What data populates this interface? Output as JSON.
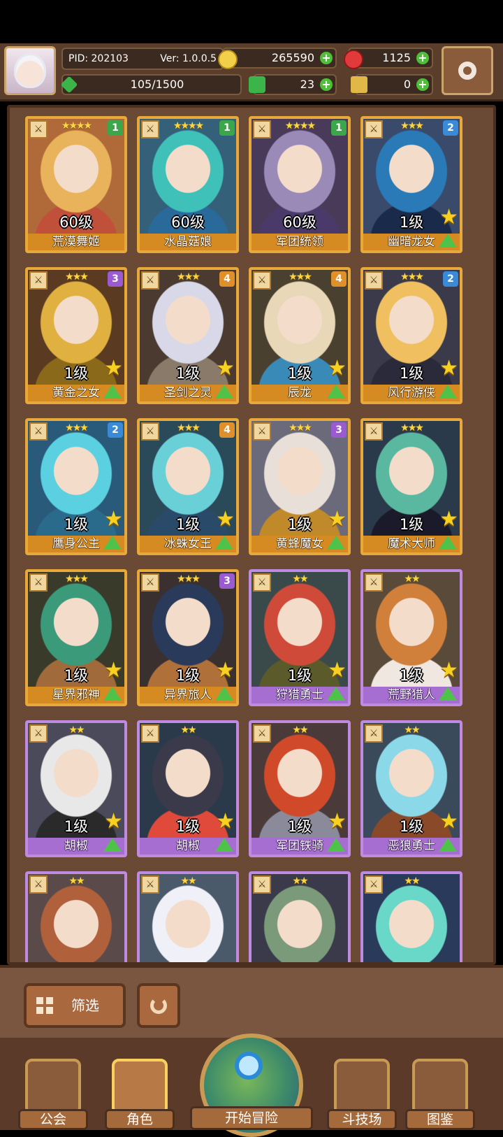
{
  "header": {
    "pid": "PID: 202103",
    "version": "Ver: 1.0.0.5",
    "gold": "265590",
    "gems": "1125",
    "energy": "105/1500",
    "clover": "23",
    "key": "0"
  },
  "cards": [
    {
      "level": "60级",
      "name": "荒漠舞姬",
      "stars": "★★★★",
      "badge": "1",
      "rarity": "gold",
      "colors": [
        "#e8b35a",
        "#c0503a"
      ],
      "bg": "#b06a3a",
      "star": false
    },
    {
      "level": "60级",
      "name": "水晶菇娘",
      "stars": "★★★★",
      "badge": "1",
      "rarity": "gold",
      "colors": [
        "#3fc0b8",
        "#2a6a9a"
      ],
      "bg": "#35607a",
      "star": false
    },
    {
      "level": "60级",
      "name": "军团统领",
      "stars": "★★★★",
      "badge": "1",
      "rarity": "gold",
      "colors": [
        "#9a8ab8",
        "#4a3a6a"
      ],
      "bg": "#4a3a5a",
      "star": false
    },
    {
      "level": "1级",
      "name": "幽暗龙女",
      "stars": "★★★",
      "badge": "2",
      "rarity": "gold",
      "colors": [
        "#2a7ab8",
        "#1a2a4a"
      ],
      "bg": "#3a4a6a",
      "star": true
    },
    {
      "level": "1级",
      "name": "黄金之女",
      "stars": "★★★",
      "badge": "3",
      "rarity": "gold",
      "colors": [
        "#e0b040",
        "#8a6a1a"
      ],
      "bg": "#5a3a20",
      "star": true
    },
    {
      "level": "1级",
      "name": "圣剑之灵",
      "stars": "★★★",
      "badge": "4",
      "rarity": "gold",
      "colors": [
        "#d8d8e8",
        "#8a7a6a"
      ],
      "bg": "#4a3a30",
      "star": true
    },
    {
      "level": "1级",
      "name": "辰龙",
      "stars": "★★★",
      "badge": "4",
      "rarity": "gold",
      "colors": [
        "#e8d8b8",
        "#3a8ab8"
      ],
      "bg": "#4a4030",
      "star": true
    },
    {
      "level": "1级",
      "name": "风行游侠",
      "stars": "★★★",
      "badge": "2",
      "rarity": "gold",
      "colors": [
        "#f0c060",
        "#2a2a3a"
      ],
      "bg": "#3a3a4a",
      "star": true
    },
    {
      "level": "1级",
      "name": "鹰身公主",
      "stars": "★★★",
      "badge": "2",
      "rarity": "gold",
      "colors": [
        "#5ad0e0",
        "#2a6a8a"
      ],
      "bg": "#2a5a7a",
      "star": true
    },
    {
      "level": "1级",
      "name": "冰蛛女王",
      "stars": "★★★",
      "badge": "4",
      "rarity": "gold",
      "colors": [
        "#6ad0d8",
        "#2a4a6a"
      ],
      "bg": "#2a4a5a",
      "star": true
    },
    {
      "level": "1级",
      "name": "黄蜂魔女",
      "stars": "★★★",
      "badge": "3",
      "rarity": "gold",
      "colors": [
        "#e8e0d8",
        "#c08a2a"
      ],
      "bg": "#6a6a7a",
      "star": true
    },
    {
      "level": "1级",
      "name": "魔术大师",
      "stars": "★★★",
      "badge": "",
      "rarity": "gold",
      "colors": [
        "#5ab8a0",
        "#1a1a2a"
      ],
      "bg": "#2a3a4a",
      "star": true
    },
    {
      "level": "1级",
      "name": "星界邪神",
      "stars": "★★★",
      "badge": "",
      "rarity": "gold",
      "colors": [
        "#3a9a7a",
        "#a06a3a"
      ],
      "bg": "#3a3a2a",
      "star": true
    },
    {
      "level": "1级",
      "name": "异界旅人",
      "stars": "★★★",
      "badge": "3",
      "rarity": "gold",
      "colors": [
        "#2a3a5a",
        "#b0703a"
      ],
      "bg": "#3a3030",
      "star": true
    },
    {
      "level": "1级",
      "name": "狩猎勇士",
      "stars": "★★",
      "badge": "",
      "rarity": "purple",
      "colors": [
        "#d04a3a",
        "#5a5a2a"
      ],
      "bg": "#3a4a4a",
      "star": true
    },
    {
      "level": "1级",
      "name": "荒野猎人",
      "stars": "★★",
      "badge": "",
      "rarity": "purple",
      "colors": [
        "#d0803a",
        "#f0e8e0"
      ],
      "bg": "#5a4a3a",
      "star": true
    },
    {
      "level": "1级",
      "name": "胡椒",
      "stars": "★★",
      "badge": "",
      "rarity": "purple",
      "colors": [
        "#e8e8e8",
        "#2a2a2a"
      ],
      "bg": "#4a4a5a",
      "star": true
    },
    {
      "level": "1级",
      "name": "胡椒",
      "stars": "★★",
      "badge": "",
      "rarity": "purple",
      "colors": [
        "#3a3a4a",
        "#e04a3a"
      ],
      "bg": "#2a3a4a",
      "star": true
    },
    {
      "level": "1级",
      "name": "军团铁骑",
      "stars": "★★",
      "badge": "",
      "rarity": "purple",
      "colors": [
        "#d04a2a",
        "#8a8a9a"
      ],
      "bg": "#4a3a3a",
      "star": true
    },
    {
      "level": "1级",
      "name": "恶狼勇士",
      "stars": "★★",
      "badge": "",
      "rarity": "purple",
      "colors": [
        "#8ad8e8",
        "#8a4a2a"
      ],
      "bg": "#3a4a5a",
      "star": true
    },
    {
      "level": "",
      "name": "",
      "stars": "★★",
      "badge": "",
      "rarity": "purple",
      "colors": [
        "#b0603a",
        "#2a2a2a"
      ],
      "bg": "#5a4a4a",
      "star": false
    },
    {
      "level": "",
      "name": "",
      "stars": "★★",
      "badge": "",
      "rarity": "purple",
      "colors": [
        "#f0f0f8",
        "#8ab8d8"
      ],
      "bg": "#4a5a6a",
      "star": false
    },
    {
      "level": "",
      "name": "",
      "stars": "★★",
      "badge": "",
      "rarity": "purple",
      "colors": [
        "#7a9a7a",
        "#4a6a4a"
      ],
      "bg": "#3a3a4a",
      "star": false
    },
    {
      "level": "",
      "name": "",
      "stars": "★★",
      "badge": "",
      "rarity": "purple",
      "colors": [
        "#6ad8c8",
        "#2a8a8a"
      ],
      "bg": "#2a3a5a",
      "star": false
    }
  ],
  "toolbar": {
    "filter": "筛选"
  },
  "nav": {
    "guild": "公会",
    "roles": "角色",
    "adventure": "开始冒险",
    "arena": "斗技场",
    "codex": "图鉴"
  }
}
